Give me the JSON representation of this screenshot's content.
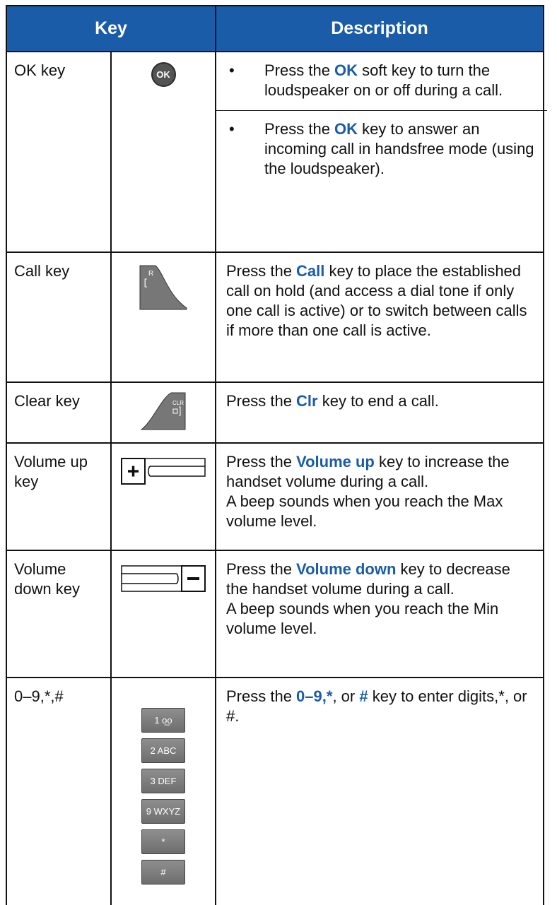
{
  "header": {
    "key": "Key",
    "description": "Description"
  },
  "rows": [
    {
      "name": "OK key",
      "icon": "ok-key-icon",
      "icon_label": "OK",
      "bullets": [
        {
          "pre": "Press the ",
          "hl": "OK",
          "post": " soft key to turn the loudspeaker on or off during a call."
        },
        {
          "pre": "Press the ",
          "hl": "OK",
          "post": " key to answer an incoming call in handsfree mode (using the loudspeaker)."
        }
      ]
    },
    {
      "name": "Call key",
      "icon": "call-key-icon",
      "icon_top": "R",
      "icon_bottom": "[",
      "pre": "Press the ",
      "hl": "Call",
      "post": " key to place the established call on hold (and access a dial tone if only one call is active) or to switch between calls if more than one call is active."
    },
    {
      "name": "Clear key",
      "icon": "clear-key-icon",
      "icon_label": "CLR",
      "pre": "Press the ",
      "hl": "Clr",
      "post": " key to end a call."
    },
    {
      "name": "Volume up key",
      "icon": "volume-up-key-icon",
      "pre": "Press the ",
      "hl": "Volume up",
      "post": " key to increase the handset volume during a call.",
      "line2": "A beep sounds when you reach the Max volume level."
    },
    {
      "name": "Volume down key",
      "icon": "volume-down-key-icon",
      "pre": "Press the ",
      "hl": "Volume down",
      "post": " key to decrease the handset volume during a call.",
      "line2": "A beep sounds when you reach the Min volume level."
    },
    {
      "name": "0–9,*,#",
      "icon": "keypad-keys-icon",
      "keys": [
        "1 ᴏ̲ᴏ",
        "2 ABC",
        "3 DEF",
        "9 WXYZ",
        "*",
        "#"
      ],
      "pre": "Press the ",
      "hl1": "0–9",
      "mid1": ",",
      "hl2": "*",
      "mid2": ", or ",
      "hl3": "#",
      "post": " key to enter digits,*, or #."
    }
  ]
}
